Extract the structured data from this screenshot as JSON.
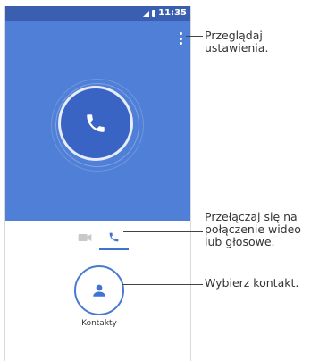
{
  "status_bar": {
    "time": "11:35"
  },
  "contacts": {
    "label": "Kontakty"
  },
  "callouts": {
    "settings": [
      "Przeglądaj",
      "ustawienia."
    ],
    "toggle": [
      "Przełączaj się na",
      "połączenie wideo",
      "lub głosowe."
    ],
    "contact": [
      "Wybierz kontakt."
    ]
  }
}
